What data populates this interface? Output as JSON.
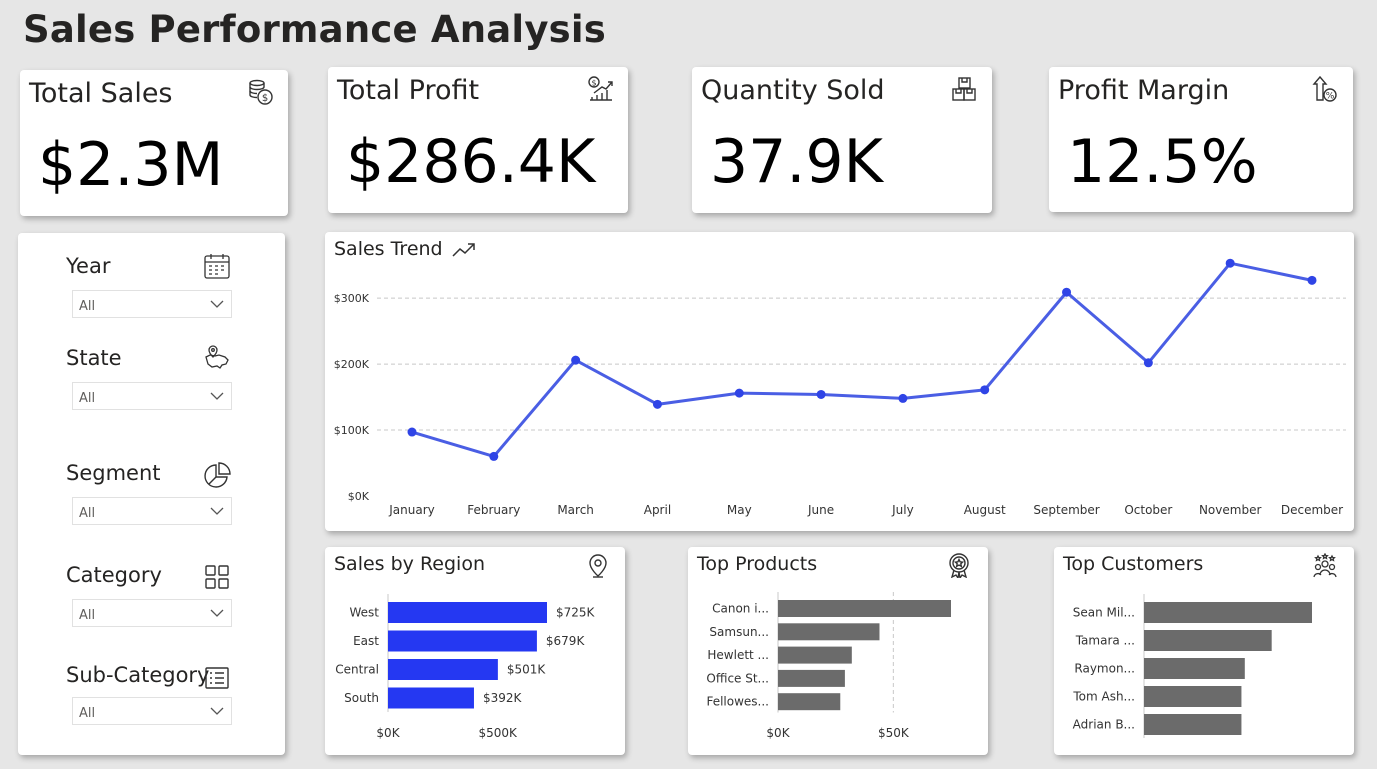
{
  "page": {
    "title": "Sales Performance Analysis"
  },
  "kpis": [
    {
      "label": "Total Sales",
      "value": "$2.3M",
      "icon": "coins-icon"
    },
    {
      "label": "Total Profit",
      "value": "$286.4K",
      "icon": "growth-chart-icon"
    },
    {
      "label": "Quantity Sold",
      "value": "37.9K",
      "icon": "boxes-icon"
    },
    {
      "label": "Profit Margin",
      "value": "12.5%",
      "icon": "percent-up-icon"
    }
  ],
  "slicers": [
    {
      "label": "Year",
      "value": "All",
      "icon": "calendar-icon"
    },
    {
      "label": "State",
      "value": "All",
      "icon": "map-pin-icon"
    },
    {
      "label": "Segment",
      "value": "All",
      "icon": "pie-icon"
    },
    {
      "label": "Category",
      "value": "All",
      "icon": "grid-icon"
    },
    {
      "label": "Sub-Category",
      "value": "All",
      "icon": "list-icon"
    }
  ],
  "panels": {
    "trend": {
      "title": "Sales Trend",
      "icon": "trend-up-icon"
    },
    "region": {
      "title": "Sales by Region",
      "icon": "location-pin-icon"
    },
    "products": {
      "title": "Top Products",
      "icon": "award-icon"
    },
    "customers": {
      "title": "Top Customers",
      "icon": "people-icon"
    }
  },
  "colors": {
    "line": "#4a5ee4",
    "region_bar": "#2538f2",
    "gray_bar": "#6b6b6b",
    "background": "#e6e6e6"
  },
  "chart_data": [
    {
      "id": "trend",
      "type": "line",
      "x": [
        "January",
        "February",
        "March",
        "April",
        "May",
        "June",
        "July",
        "August",
        "September",
        "October",
        "November",
        "December"
      ],
      "values": [
        97000,
        60000,
        206000,
        139000,
        156000,
        154000,
        148000,
        161000,
        309000,
        202000,
        353000,
        327000
      ],
      "yticks": [
        "$0K",
        "$100K",
        "$200K",
        "$300K"
      ],
      "ytick_values": [
        0,
        100000,
        200000,
        300000
      ],
      "ylim": [
        0,
        370000
      ],
      "grid": true
    },
    {
      "id": "region",
      "type": "bar",
      "orientation": "horizontal",
      "categories": [
        "West",
        "East",
        "Central",
        "South"
      ],
      "values": [
        725,
        679,
        501,
        392
      ],
      "labels": [
        "$725K",
        "$679K",
        "$501K",
        "$392K"
      ],
      "xticks": [
        "$0K",
        "$500K"
      ],
      "xtick_values": [
        0,
        500
      ],
      "xlim": [
        0,
        725
      ]
    },
    {
      "id": "products",
      "type": "bar",
      "orientation": "horizontal",
      "categories": [
        "Canon i...",
        "Samsun...",
        "Hewlett ...",
        "Office St...",
        "Fellowes..."
      ],
      "values": [
        75,
        44,
        32,
        29,
        27
      ],
      "xticks": [
        "$0K",
        "$50K"
      ],
      "xtick_values": [
        0,
        50
      ],
      "xlim": [
        0,
        75
      ],
      "grid": true
    },
    {
      "id": "customers",
      "type": "bar",
      "orientation": "horizontal",
      "categories": [
        "Sean Mil...",
        "Tamara ...",
        "Raymon...",
        "Tom Ash...",
        "Adrian B..."
      ],
      "values": [
        25,
        19,
        15,
        14.5,
        14.5
      ],
      "xlim": [
        0,
        25
      ]
    }
  ]
}
